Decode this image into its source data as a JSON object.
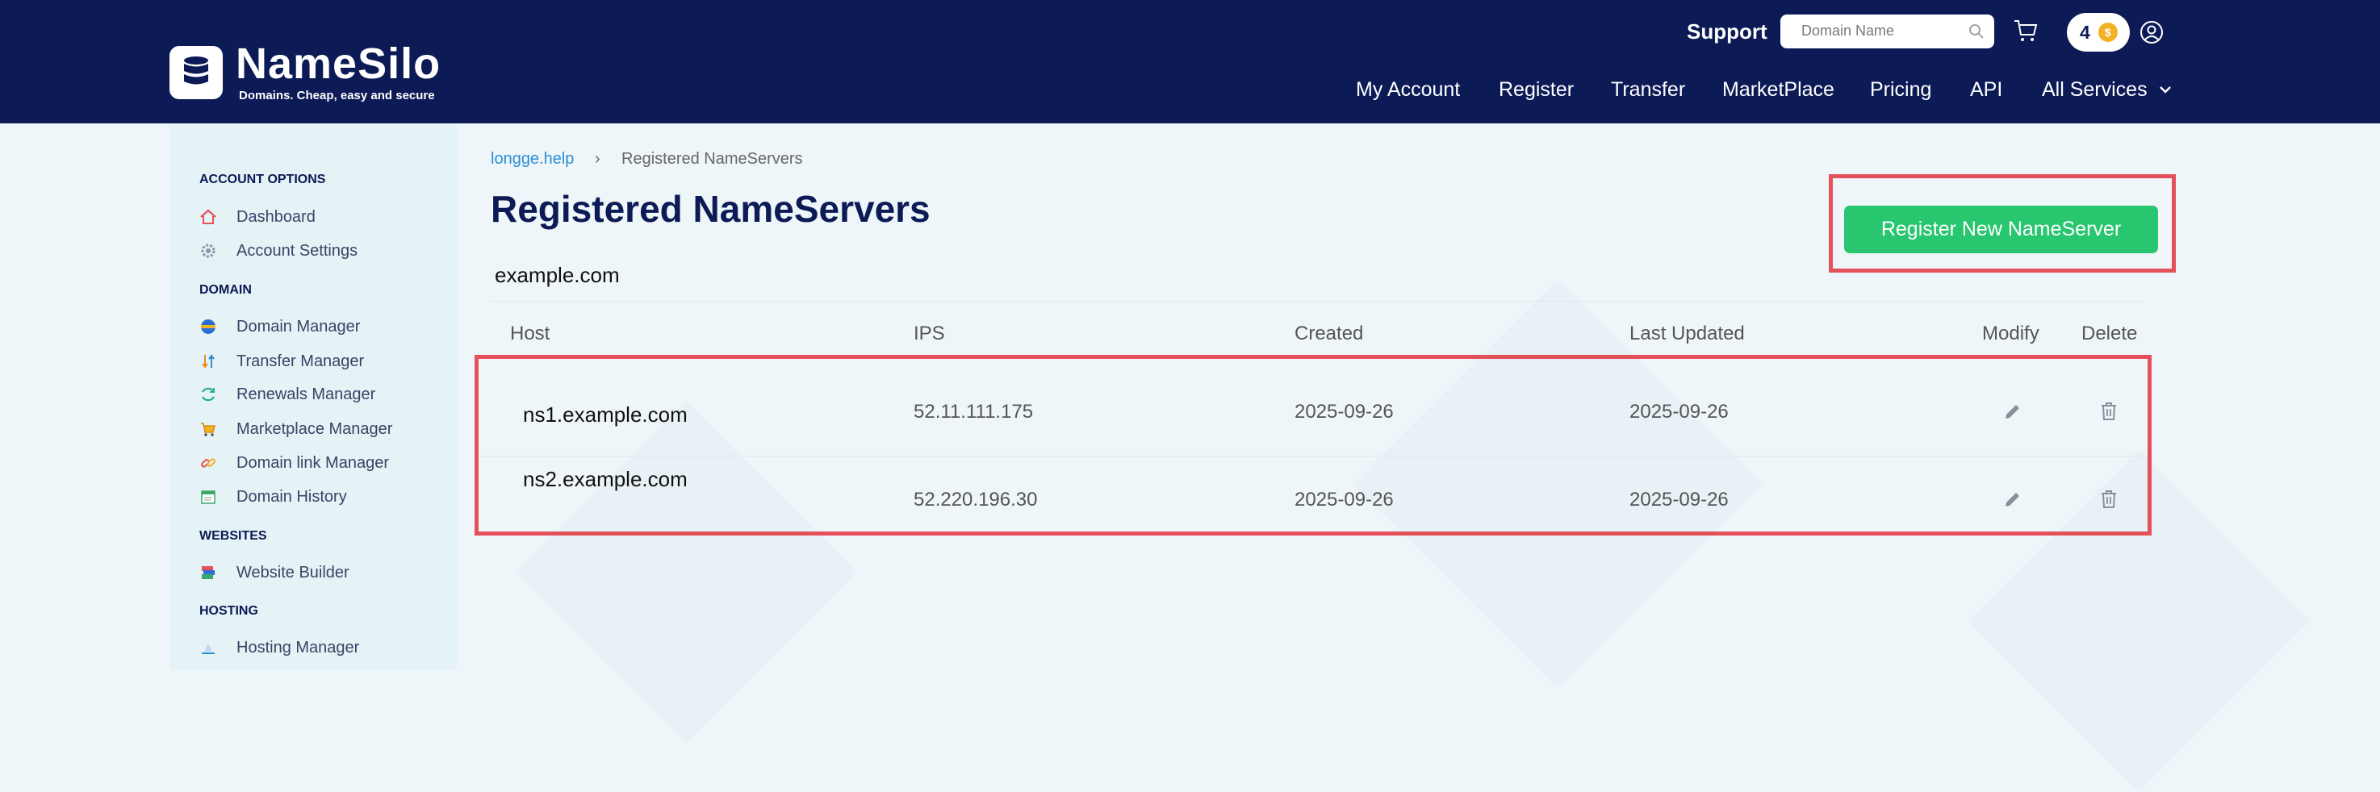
{
  "brand": {
    "name": "NameSilo",
    "tagline": "Domains. Cheap, easy and secure"
  },
  "header": {
    "support_label": "Support",
    "search_placeholder": "Domain Name",
    "coin_count": "4",
    "nav": [
      "My Account",
      "Register",
      "Transfer",
      "MarketPlace",
      "Pricing",
      "API",
      "All Services"
    ]
  },
  "sidebar": {
    "sections": [
      {
        "title": "ACCOUNT OPTIONS",
        "items": [
          {
            "label": "Dashboard",
            "icon": "home-icon"
          },
          {
            "label": "Account Settings",
            "icon": "gear-icon"
          }
        ]
      },
      {
        "title": "DOMAIN",
        "items": [
          {
            "label": "Domain Manager",
            "icon": "globe-icon"
          },
          {
            "label": "Transfer Manager",
            "icon": "transfer-icon"
          },
          {
            "label": "Renewals Manager",
            "icon": "renew-icon"
          },
          {
            "label": "Marketplace Manager",
            "icon": "cart-icon"
          },
          {
            "label": "Domain link Manager",
            "icon": "link-icon"
          },
          {
            "label": "Domain History",
            "icon": "history-icon"
          }
        ]
      },
      {
        "title": "WEBSITES",
        "items": [
          {
            "label": "Website Builder",
            "icon": "builder-icon"
          }
        ]
      },
      {
        "title": "HOSTING",
        "items": [
          {
            "label": "Hosting Manager",
            "icon": "hosting-icon"
          }
        ]
      }
    ]
  },
  "breadcrumb": {
    "link": "longge.help",
    "separator": "›",
    "current": "Registered NameServers"
  },
  "page": {
    "title": "Registered NameServers",
    "domain": "example.com",
    "register_button": "Register New NameServer"
  },
  "table": {
    "columns": [
      "Host",
      "IPS",
      "Created",
      "Last Updated",
      "Modify",
      "Delete"
    ],
    "rows": [
      {
        "host": "ns1.example.com",
        "ips": "52.11.111.175",
        "created": "2025-09-26",
        "updated": "2025-09-26"
      },
      {
        "host": "ns2.example.com",
        "ips": "52.220.196.30",
        "created": "2025-09-26",
        "updated": "2025-09-26"
      }
    ]
  },
  "colors": {
    "navy": "#0c1a55",
    "accent_green": "#28c76f",
    "link_blue": "#2c8ed6",
    "highlight_red": "#e5515a"
  }
}
